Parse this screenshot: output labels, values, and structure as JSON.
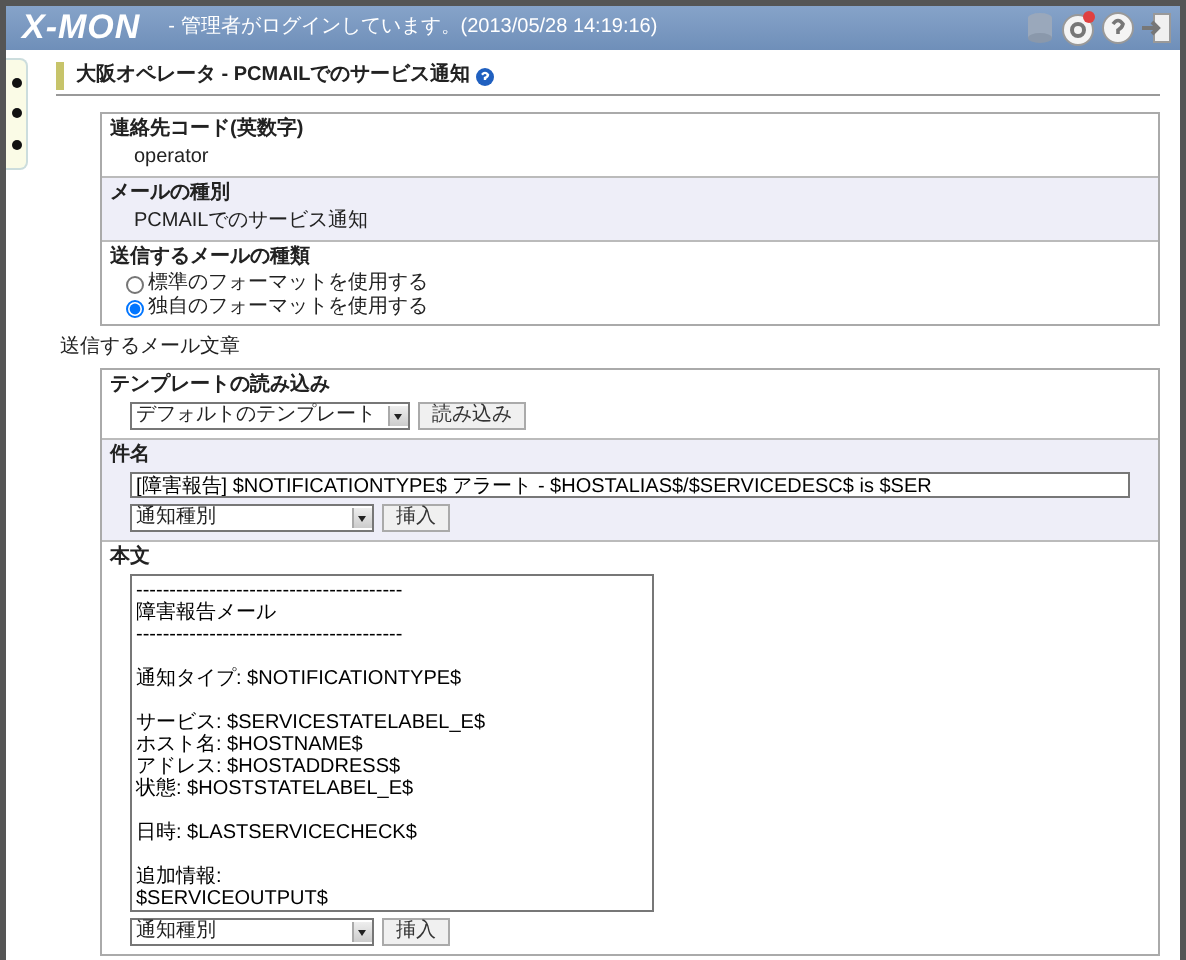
{
  "header": {
    "logo": "X-MON",
    "login_status": "- 管理者がログインしています。(2013/05/28 14:19:16)"
  },
  "page_title": "大阪オペレータ - PCMAILでのサービス通知",
  "settings": [
    {
      "kind": "text",
      "label": "連絡先コード(英数字)",
      "value": "operator"
    },
    {
      "kind": "text",
      "label": "メールの種別",
      "value": "PCMAILでのサービス通知"
    },
    {
      "kind": "radio",
      "label": "送信するメールの種類",
      "options": [
        {
          "label": "標準のフォーマットを使用する",
          "selected": false
        },
        {
          "label": "独自のフォーマットを使用する",
          "selected": true
        }
      ]
    }
  ],
  "mail_section_label": "送信するメール文章",
  "template": {
    "label": "テンプレートの読み込み",
    "select": "デフォルトのテンプレート",
    "button": "読み込み"
  },
  "subject": {
    "label": "件名",
    "value": "[障害報告] $NOTIFICATIONTYPE$ アラート - $HOSTALIAS$/$SERVICEDESC$ is $SER",
    "insert_select": "通知種別",
    "insert_button": "挿入"
  },
  "body": {
    "label": "本文",
    "value": "----------------------------------------\n障害報告メール\n----------------------------------------\n\n通知タイプ: $NOTIFICATIONTYPE$\n\nサービス: $SERVICESTATELABEL_E$\nホスト名: $HOSTNAME$\nアドレス: $HOSTADDRESS$\n状態: $HOSTSTATELABEL_E$\n\n日時: $LASTSERVICECHECK$\n\n追加情報:\n$SERVICEOUTPUT$",
    "insert_select": "通知種別",
    "insert_button": "挿入"
  }
}
